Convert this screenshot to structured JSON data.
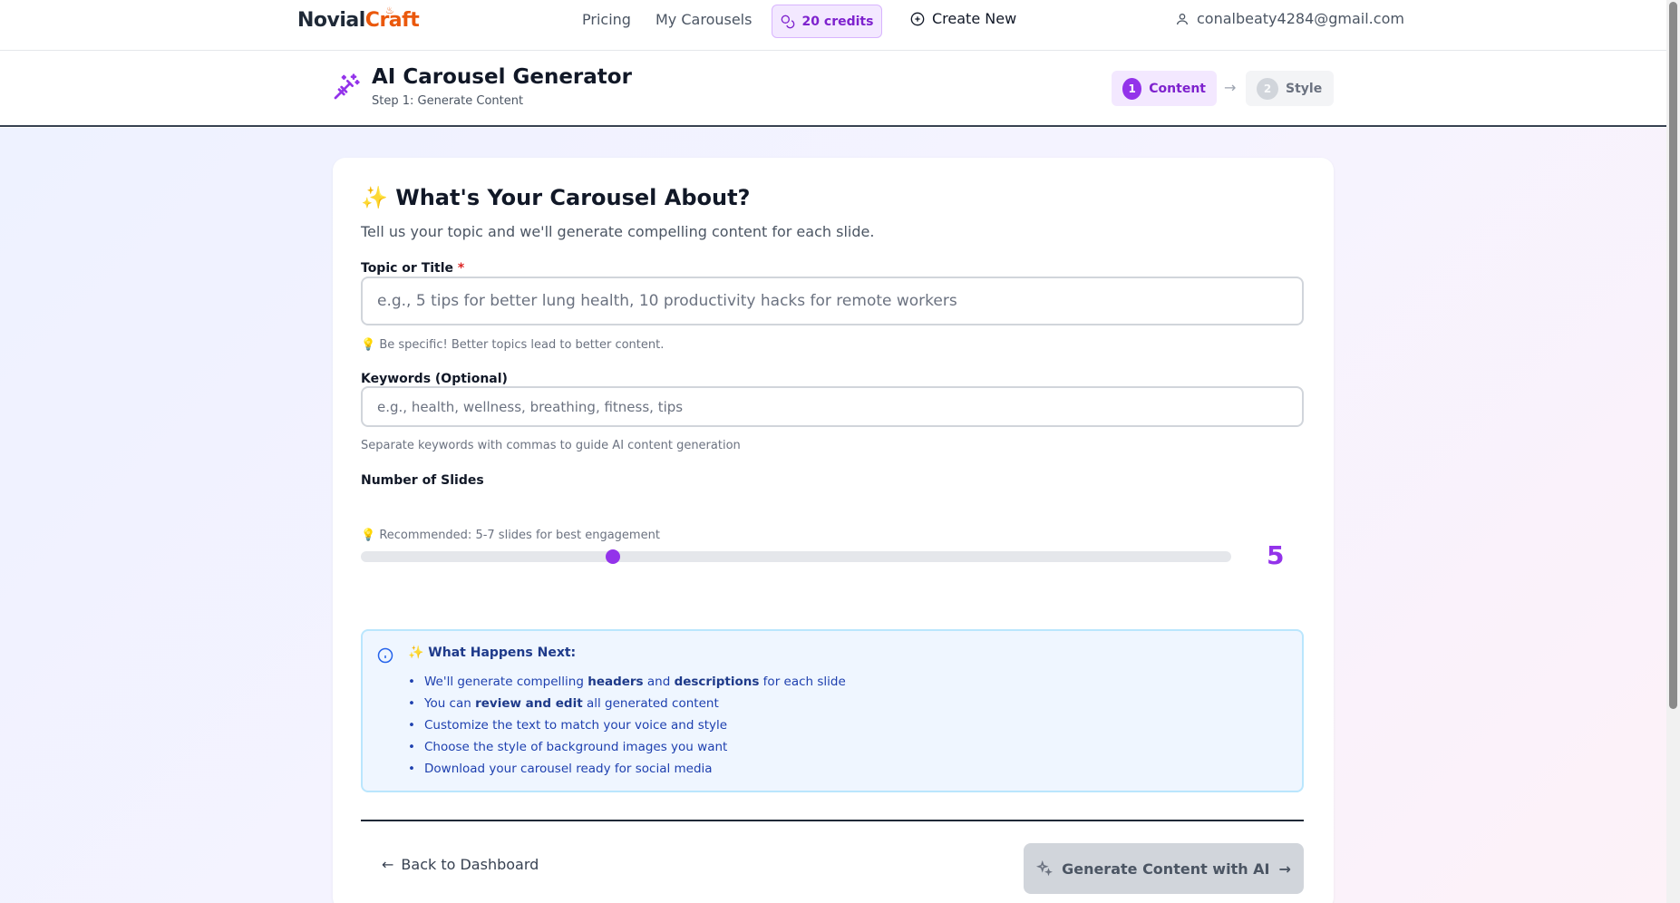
{
  "nav": {
    "logo_main": "Novial",
    "logo_accent": "Craft",
    "links": [
      "Pricing",
      "My Carousels"
    ],
    "credits": "20 credits",
    "create_new": "Create New",
    "user_email": "conalbeaty4284@gmail.com"
  },
  "header": {
    "title": "AI Carousel Generator",
    "subtitle": "Step 1: Generate Content",
    "steps": [
      {
        "num": "1",
        "label": "Content",
        "active": true
      },
      {
        "num": "2",
        "label": "Style",
        "active": false
      }
    ]
  },
  "form": {
    "title": "✨ What's Your Carousel About?",
    "description": "Tell us your topic and we'll generate compelling content for each slide.",
    "topic": {
      "label": "Topic or Title",
      "required_mark": "*",
      "placeholder": "e.g., 5 tips for better lung health, 10 productivity hacks for remote workers",
      "value": "",
      "hint": "💡 Be specific! Better topics lead to better content."
    },
    "keywords": {
      "label": "Keywords (Optional)",
      "placeholder": "e.g., health, wellness, breathing, fitness, tips",
      "value": "",
      "hint": "Separate keywords with commas to guide AI content generation"
    },
    "slides": {
      "label": "Number of Slides",
      "value": "5",
      "fraction": 0.29,
      "hint": "💡 Recommended: 5-7 slides for best engagement"
    }
  },
  "info": {
    "title": "✨ What Happens Next:",
    "items": [
      {
        "pre": "We'll generate compelling ",
        "b1": "headers",
        "mid": " and ",
        "b2": "descriptions",
        "post": " for each slide"
      },
      {
        "pre": "You can ",
        "b1": "review and edit",
        "mid": "",
        "b2": "",
        "post": " all generated content"
      },
      {
        "pre": "Customize the text to match your voice and style",
        "b1": "",
        "mid": "",
        "b2": "",
        "post": ""
      },
      {
        "pre": "Choose the style of background images you want",
        "b1": "",
        "mid": "",
        "b2": "",
        "post": ""
      },
      {
        "pre": "Download your carousel ready for social media",
        "b1": "",
        "mid": "",
        "b2": "",
        "post": ""
      }
    ]
  },
  "actions": {
    "back": "Back to Dashboard",
    "generate": "Generate Content with AI"
  },
  "colors": {
    "brand_purple": "#9333ea",
    "logo_orange": "#ea580c",
    "info_blue": "#1e40af"
  }
}
